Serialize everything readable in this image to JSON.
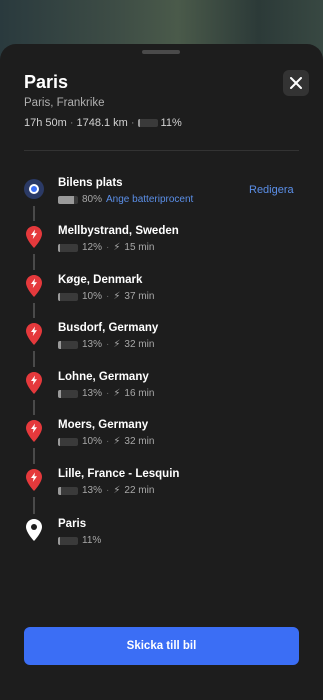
{
  "trip": {
    "title": "Paris",
    "subtitle": "Paris, Frankrike",
    "duration": "17h 50m",
    "distance": "1748.1 km",
    "arrival_battery": "11%",
    "arrival_battery_level": 0.11
  },
  "origin": {
    "name": "Bilens plats",
    "battery": "80%",
    "battery_level": 0.8,
    "set_battery_label": "Ange batteriprocent",
    "edit_label": "Redigera"
  },
  "chargers": [
    {
      "name": "Mellbystrand, Sweden",
      "battery": "12%",
      "battery_level": 0.12,
      "charge_time": "15 min"
    },
    {
      "name": "Køge, Denmark",
      "battery": "10%",
      "battery_level": 0.1,
      "charge_time": "37 min"
    },
    {
      "name": "Busdorf, Germany",
      "battery": "13%",
      "battery_level": 0.13,
      "charge_time": "32 min"
    },
    {
      "name": "Lohne, Germany",
      "battery": "13%",
      "battery_level": 0.13,
      "charge_time": "16 min"
    },
    {
      "name": "Moers, Germany",
      "battery": "10%",
      "battery_level": 0.1,
      "charge_time": "32 min"
    },
    {
      "name": "Lille, France - Lesquin",
      "battery": "13%",
      "battery_level": 0.13,
      "charge_time": "22 min"
    }
  ],
  "destination": {
    "name": "Paris",
    "battery": "11%",
    "battery_level": 0.11
  },
  "send_button": "Skicka till bil",
  "separator": "·",
  "colors": {
    "accent": "#3b6ef5",
    "link": "#5b8fe8",
    "charger_pin": "#e5393c",
    "sheet": "#1d1d1d"
  },
  "icons": [
    "close-icon",
    "current-location-icon",
    "charger-pin-icon",
    "destination-pin-icon",
    "battery-icon",
    "bolt-icon"
  ]
}
